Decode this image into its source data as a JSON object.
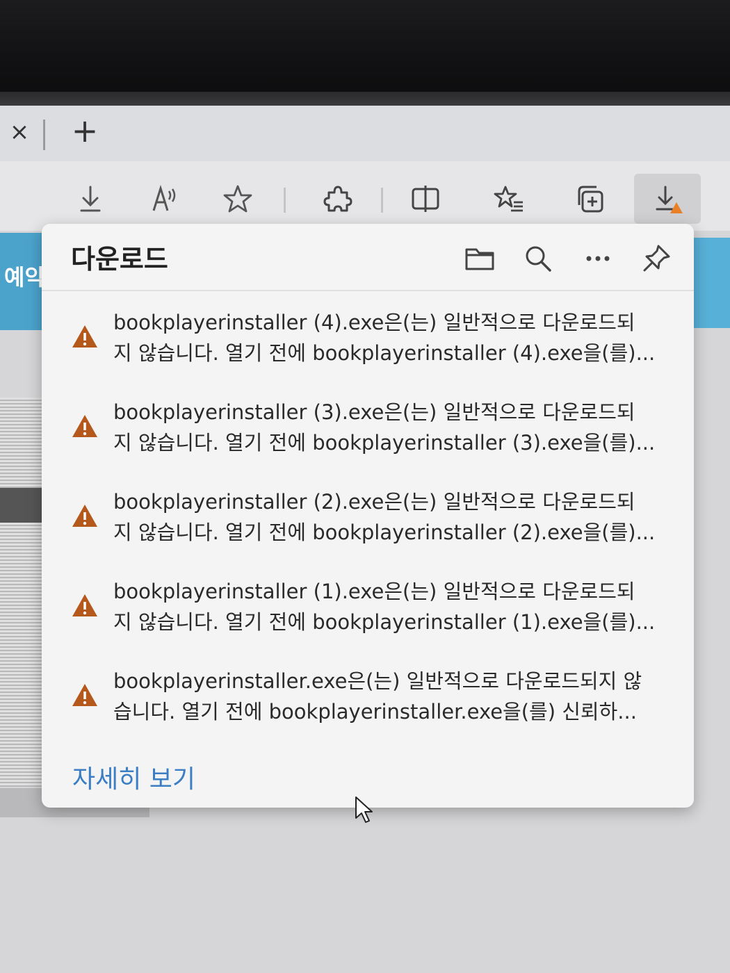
{
  "tabstrip": {
    "close_glyph": "×",
    "new_tab_glyph": "+"
  },
  "toolbar": {
    "buttons": [
      {
        "name": "download-icon"
      },
      {
        "name": "read-aloud-icon"
      },
      {
        "name": "favorite-star-icon"
      },
      {
        "name": "extensions-icon"
      },
      {
        "name": "split-screen-icon"
      },
      {
        "name": "favorites-list-icon"
      },
      {
        "name": "collections-icon"
      },
      {
        "name": "downloads-warning-icon"
      }
    ]
  },
  "page": {
    "left_text": "예약"
  },
  "downloads": {
    "title": "다운로드",
    "header_icons": [
      "folder-icon",
      "search-icon",
      "more-icon",
      "pin-icon"
    ],
    "items": [
      {
        "line1": "bookplayerinstaller (4).exe은(는) 일반적으로 다운로드되",
        "line2": "지 않습니다. 열기 전에 bookplayerinstaller (4).exe을(를)..."
      },
      {
        "line1": "bookplayerinstaller (3).exe은(는) 일반적으로 다운로드되",
        "line2": "지 않습니다. 열기 전에 bookplayerinstaller (3).exe을(를)..."
      },
      {
        "line1": "bookplayerinstaller (2).exe은(는) 일반적으로 다운로드되",
        "line2": "지 않습니다. 열기 전에 bookplayerinstaller (2).exe을(를)..."
      },
      {
        "line1": "bookplayerinstaller (1).exe은(는) 일반적으로 다운로드되",
        "line2": "지 않습니다. 열기 전에 bookplayerinstaller (1).exe을(를)..."
      },
      {
        "line1": "bookplayerinstaller.exe은(는) 일반적으로 다운로드되지 않",
        "line2": "습니다. 열기 전에 bookplayerinstaller.exe을(를) 신뢰하..."
      }
    ],
    "see_more": "자세히 보기"
  },
  "colors": {
    "warning": "#b5581c",
    "link": "#3b7ec4",
    "accent_badge": "#e8802a"
  }
}
